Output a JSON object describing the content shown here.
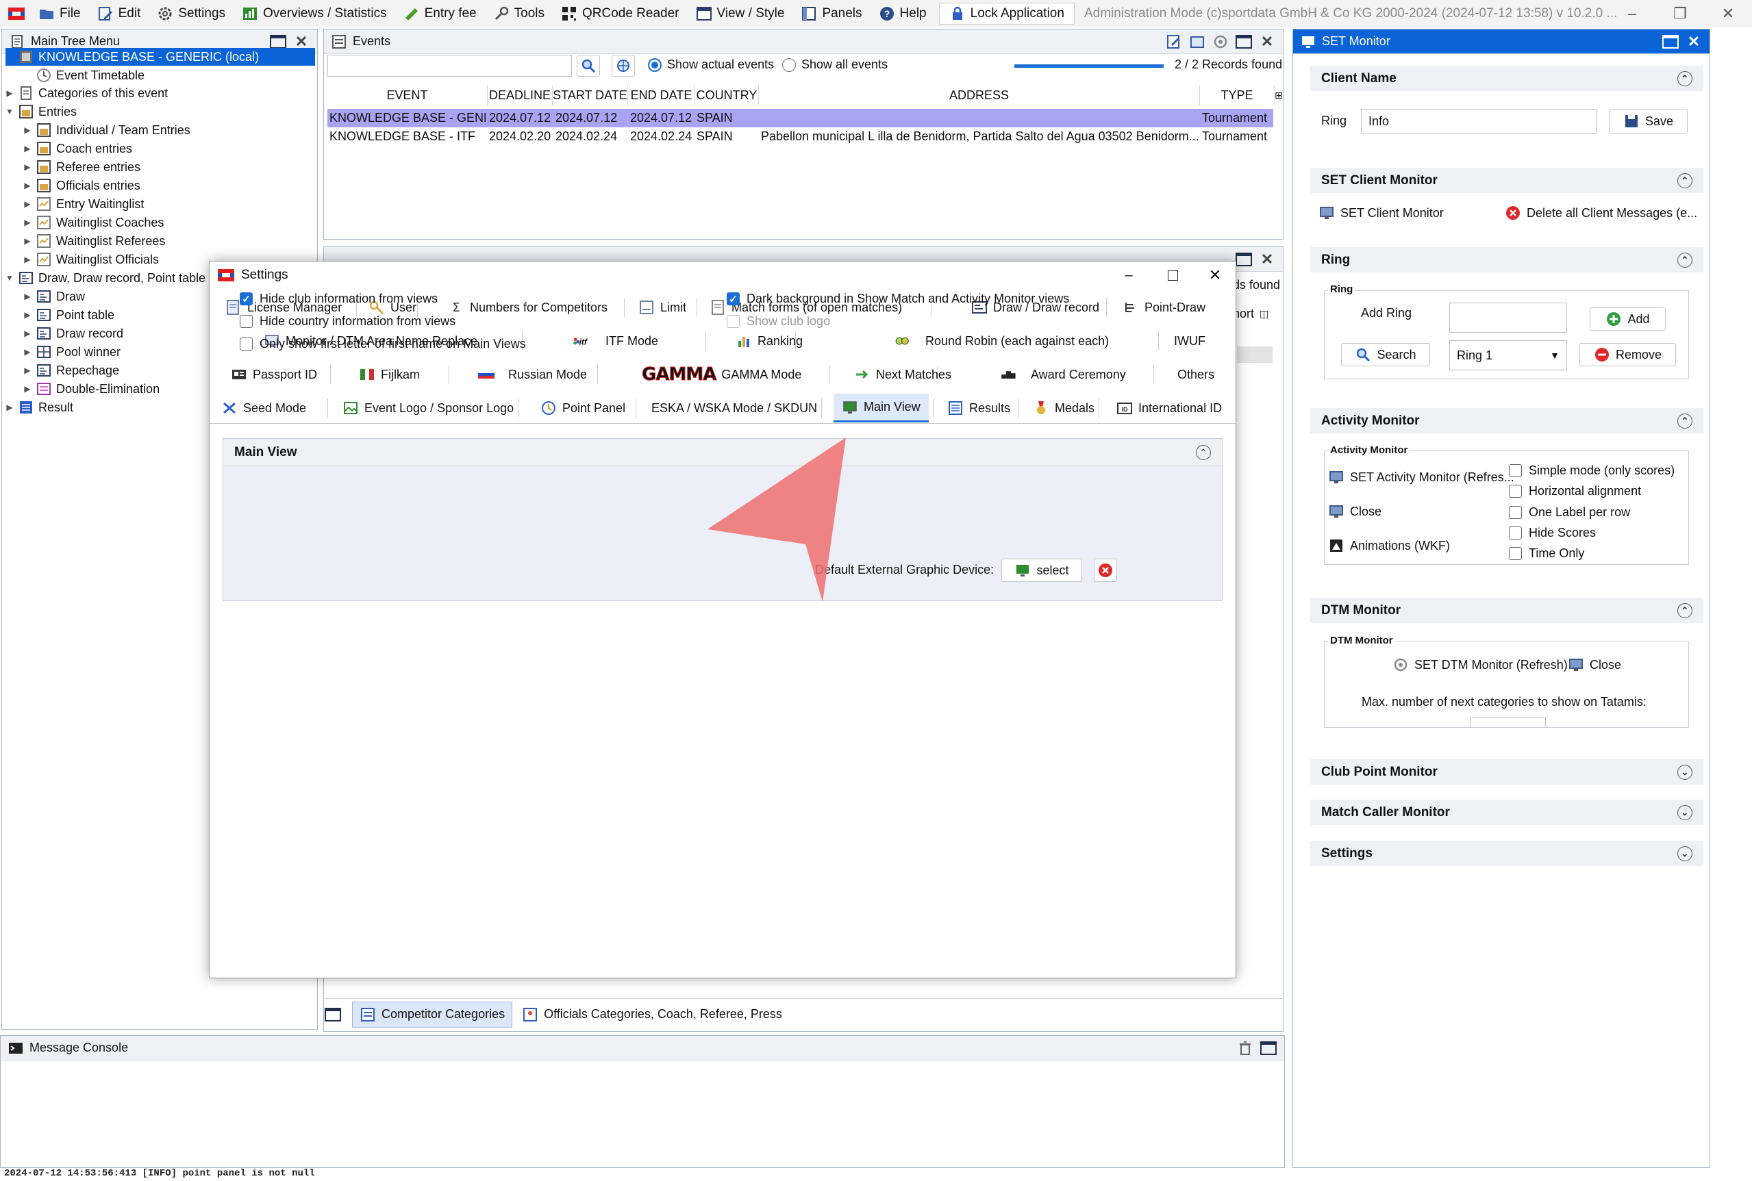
{
  "menubar": {
    "items": [
      "File",
      "Edit",
      "Settings",
      "Overviews / Statistics",
      "Entry fee",
      "Tools",
      "QRCode Reader",
      "View / Style",
      "Panels",
      "Help"
    ],
    "lock": "Lock Application",
    "admin": "Administration Mode (c)sportdata GmbH & Co KG 2000-2024 (2024-07-12 13:58)  v 10.2.0 ..."
  },
  "tree": {
    "title": "Main Tree Menu",
    "items": [
      {
        "label": "KNOWLEDGE BASE - GENERIC (local)"
      },
      {
        "label": "Event Timetable"
      },
      {
        "label": "Categories of this event"
      },
      {
        "label": "Entries"
      },
      {
        "label": "Individual / Team Entries"
      },
      {
        "label": "Coach entries"
      },
      {
        "label": "Referee entries"
      },
      {
        "label": "Officials entries"
      },
      {
        "label": "Entry Waitinglist"
      },
      {
        "label": "Waitinglist Coaches"
      },
      {
        "label": "Waitinglist Referees"
      },
      {
        "label": "Waitinglist Officials"
      },
      {
        "label": "Draw, Draw record, Point table"
      },
      {
        "label": "Draw"
      },
      {
        "label": "Point table"
      },
      {
        "label": "Draw record"
      },
      {
        "label": "Pool winner"
      },
      {
        "label": "Repechage"
      },
      {
        "label": "Double-Elimination"
      },
      {
        "label": "Result"
      }
    ]
  },
  "events": {
    "title": "Events",
    "show_actual": "Show actual events",
    "show_all": "Show all events",
    "records": "2 / 2 Records found",
    "columns": [
      "EVENT",
      "DEADLINE",
      "START DATE",
      "END DATE",
      "COUNTRY",
      "ADDRESS",
      "TYPE"
    ],
    "rows": [
      [
        "KNOWLEDGE BASE - GENE...",
        "2024.07.12",
        "2024.07.12",
        "2024.07.12",
        "SPAIN",
        "",
        "Tournament"
      ],
      [
        "KNOWLEDGE BASE - ITF",
        "2024.02.20",
        "2024.02.24",
        "2024.02.24",
        "SPAIN",
        "Pabellon municipal L illa de Benidorm, Partida Salto del Agua 03502 Benidorm...",
        "Tournament"
      ]
    ]
  },
  "competitor": {
    "title": "Competitor Categories",
    "records_partial": "ds found",
    "short_partial": "hort",
    "bottom_tabs": [
      "Competitor Categories",
      "Officials Categories, Coach, Referee, Press"
    ]
  },
  "settings_dialog": {
    "title": "Settings",
    "tab_rows": [
      [
        "License Manager",
        "User",
        "Numbers for Competitors",
        "Limit",
        "Match forms (of open matches)",
        "Draw / Draw record",
        "Point-Draw"
      ],
      [
        "Monitor / DTM Area Name Replace",
        "ITF Mode",
        "Ranking",
        "Round Robin (each against each)",
        "IWUF"
      ],
      [
        "Passport ID",
        "Fijlkam",
        "Russian Mode",
        "GAMMA Mode",
        "Next Matches",
        "Award Ceremony",
        "Others"
      ],
      [
        "Seed Mode",
        "Event Logo / Sponsor Logo",
        "Point Panel",
        "ESKA / WSKA Mode / SKDUN",
        "Main View",
        "Results",
        "Medals",
        "International ID"
      ]
    ],
    "itf_logo": "ITF",
    "gamma_logo": "GAMMA",
    "section": "Main View",
    "options_left": [
      {
        "label": "Hide club information from views",
        "checked": true
      },
      {
        "label": "Hide country information from views",
        "checked": false
      },
      {
        "label": "Only show first letter of first name on Main Views",
        "checked": false
      }
    ],
    "options_right": [
      {
        "label": "Dark background in Show Match and Activity Monitor views",
        "checked": true
      },
      {
        "label": "Show club logo",
        "checked": false
      }
    ],
    "ext_device_label": "Default External Graphic Device:",
    "select_label": "select"
  },
  "set_monitor": {
    "title": "SET Monitor",
    "client_name": "Client Name",
    "ring_label": "Ring",
    "ring_value": "Info",
    "save": "Save",
    "set_client_monitor": "SET Client Monitor",
    "set_client_monitor_btn": "SET Client Monitor",
    "delete_msgs": "Delete all Client Messages (e...",
    "ring_section": "Ring",
    "ring_group": "Ring",
    "add_ring": "Add Ring",
    "add": "Add",
    "search": "Search",
    "ring_select": "Ring 1",
    "remove": "Remove",
    "activity_monitor": "Activity Monitor",
    "activity_group": "Activity Monitor",
    "set_activity": "SET Activity Monitor (Refres...",
    "close": "Close",
    "animations": "Animations (WKF)",
    "activity_opts": [
      "Simple mode (only scores)",
      "Horizontal alignment",
      "One Label per row",
      "Hide Scores",
      "Time Only"
    ],
    "dtm_monitor": "DTM Monitor",
    "dtm_group": "DTM Monitor",
    "set_dtm": "SET DTM Monitor (Refresh)",
    "dtm_close": "Close",
    "max_next": "Max. number of next categories to show on Tatamis:",
    "club_point": "Club Point Monitor",
    "match_caller": "Match Caller Monitor",
    "settings": "Settings"
  },
  "console": {
    "title": "Message Console",
    "log": "2024-07-12 14:53:56:413 [INFO] point panel is not null"
  },
  "colors": {
    "selection": "#0a64d8",
    "row_selected": "#a7a5f3",
    "checkbox": "#1a6fd6",
    "arrow": "#f07878"
  }
}
